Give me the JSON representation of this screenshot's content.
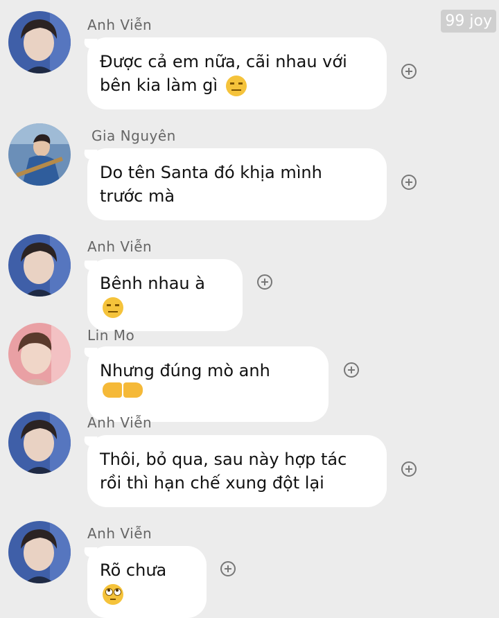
{
  "watermark": "99 joy",
  "messages": [
    {
      "sender": "Anh Viễn",
      "lines": [
        "Được cả em nữa, cãi nhau với",
        "bên kia làm gì"
      ],
      "emoji": "expressionless-face-icon"
    },
    {
      "sender": "Gia Nguyên",
      "lines": [
        "Do tên Santa đó khịa mình",
        "trước mà"
      ],
      "emoji": null
    },
    {
      "sender": "Anh Viễn",
      "lines": [
        "Bênh nhau à"
      ],
      "emoji": "expressionless-face-icon"
    },
    {
      "sender": "Lin Mo",
      "lines": [
        "Nhưng đúng mò anh"
      ],
      "emoji": "pointing-hands-icon"
    },
    {
      "sender": "Anh Viễn",
      "lines": [
        "Thôi, bỏ qua, sau này hợp tác",
        "rồi thì hạn chế xung đột lại"
      ],
      "emoji": null
    },
    {
      "sender": "Anh Viễn",
      "lines": [
        "Rõ chưa"
      ],
      "emoji": "eye-roll-face-icon"
    }
  ],
  "colors": {
    "background": "#ececec",
    "bubble": "#ffffff",
    "sender_text": "#666666",
    "watermark_bg": "#cfcfcf"
  }
}
